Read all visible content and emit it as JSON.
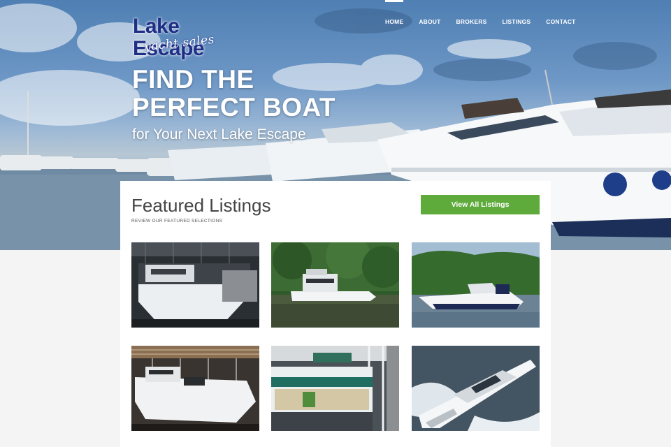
{
  "brand": {
    "name": "Lake Escape",
    "tagline": "yacht sales"
  },
  "nav": {
    "items": [
      {
        "label": "HOME",
        "active": true
      },
      {
        "label": "ABOUT",
        "active": false
      },
      {
        "label": "BROKERS",
        "active": false
      },
      {
        "label": "LISTINGS",
        "active": false
      },
      {
        "label": "CONTACT",
        "active": false
      }
    ]
  },
  "hero": {
    "title_line1": "FIND THE",
    "title_line2": "PERFECT BOAT",
    "subtitle": "for Your Next Lake Escape"
  },
  "featured": {
    "title": "Featured Listings",
    "subtitle": "REVIEW OUR FEATURED SELECTIONS",
    "button_label": "View All Listings",
    "button_color": "#5eab3c",
    "listings": [
      {
        "icon": "yacht-photo"
      },
      {
        "icon": "yacht-photo"
      },
      {
        "icon": "yacht-photo"
      },
      {
        "icon": "yacht-photo"
      },
      {
        "icon": "yacht-photo"
      },
      {
        "icon": "yacht-photo"
      }
    ]
  },
  "colors": {
    "accent": "#5eab3c",
    "logo_blue": "#1f2f86"
  }
}
